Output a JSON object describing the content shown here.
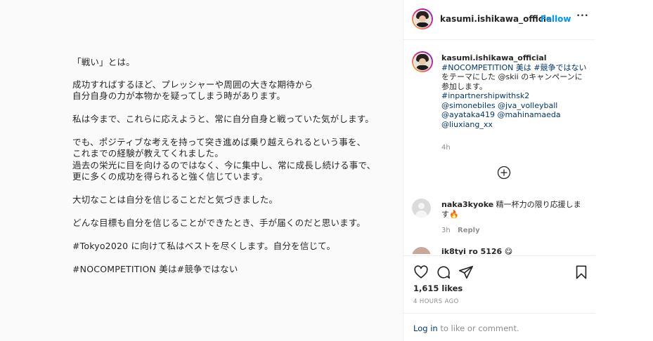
{
  "post": {
    "lines": [
      "「戦い」とは。",
      "成功すればするほど、プレッシャーや周囲の大きな期待から",
      "自分自身の力が本物かを疑ってしまう時があります。",
      "私は今まで、これらに応えようと、常に自分自身と戦っていた気がします。",
      "でも、ポジティブな考えを持って突き進めば乗り越えられるという事を、",
      "これまでの経験が教えてくれました。",
      "過去の栄光に目を向けるのではなく、今に集中し、常に成長し続ける事で、",
      "更に多くの成功を得られると強く信じています。",
      "大切なことは自分を信じることだと気づきました。",
      "どんな目標も自分を信じることができたとき、手が届くのだと思います。",
      "#Tokyo2020 に向けて私はベストを尽くします。自分を信じて。",
      "#NOCOMPETITION 美は#競争ではない"
    ]
  },
  "header": {
    "username": "kasumi.ishikawa_officia",
    "dot": "•",
    "follow": "Follow",
    "more": "•••"
  },
  "caption": {
    "username": "kasumi.ishikawa_official",
    "lines": [
      "#NOCOMPETITION 美は #競争ではない",
      "をテーマにした @skii のキャンペーンに",
      "参加します。",
      "#inpartnershipwithsk2",
      "@simonebiles @jva_volleyball",
      "@ayataka419 @mahinamaeda",
      "@liuxiang_xx"
    ],
    "time": "4h"
  },
  "comments": [
    {
      "username": "naka3kyoke",
      "text_line1": "精一杯力の限り応援しま",
      "text_line2": "す",
      "emoji": "🔥",
      "time": "3h",
      "reply": "Reply"
    },
    {
      "username": "ik8tyi ro 5126",
      "emoji": "😋"
    }
  ],
  "actions": {
    "likes": "1,615 likes",
    "timestamp": "4 HOURS AGO"
  },
  "footer": {
    "login": "Log in",
    "rest": " to like or comment."
  },
  "colors": {
    "link": "#00376b",
    "follow": "#0095f6",
    "muted": "#8e8e8e",
    "text": "#262626"
  }
}
